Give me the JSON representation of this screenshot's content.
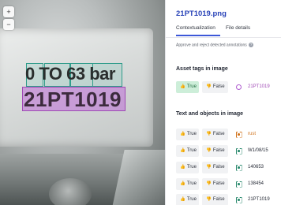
{
  "image_viewer": {
    "visible_text": {
      "range_text": "0 TO 63 bar",
      "tag_text": "21PT1019"
    },
    "controls": [
      {
        "icon": "zoom-in-icon",
        "glyph": "+"
      },
      {
        "icon": "zoom-out-icon",
        "glyph": "−"
      }
    ]
  },
  "panel": {
    "file_name": "21PT1019.png",
    "tabs": [
      {
        "label": "Contextualization",
        "active": true
      },
      {
        "label": "File details",
        "active": false
      }
    ],
    "approve_note": "Approve and reject detected annotations",
    "help_icon_glyph": "?",
    "asset_section": {
      "title": "Asset tags in image",
      "items": [
        {
          "true_label": "True",
          "false_label": "False",
          "value": "21PT1019",
          "approved": true,
          "icon": "asset-ring-icon",
          "color": "#a04ab6"
        }
      ]
    },
    "text_section": {
      "title": "Text and objects in image",
      "items": [
        {
          "true_label": "True",
          "false_label": "False",
          "value": "rust",
          "icon": "object-icon",
          "color": "#d0731c"
        },
        {
          "true_label": "True",
          "false_label": "False",
          "value": "W1/08/15",
          "icon": "text-icon",
          "color": "#2b8a6e"
        },
        {
          "true_label": "True",
          "false_label": "False",
          "value": "140653",
          "icon": "text-icon",
          "color": "#2b8a6e"
        },
        {
          "true_label": "True",
          "false_label": "False",
          "value": "138454",
          "icon": "text-icon",
          "color": "#2b8a6e"
        },
        {
          "true_label": "True",
          "false_label": "False",
          "value": "21PT1019",
          "icon": "text-icon",
          "color": "#2b8a6e"
        }
      ]
    },
    "button_glyphs": {
      "true": "👍",
      "false": "👎"
    }
  },
  "colors": {
    "accent": "#3c57d8",
    "title_blue": "#2a44b8",
    "asset_purple": "#a04ab6",
    "approved_green_bg": "#cdeed9"
  }
}
